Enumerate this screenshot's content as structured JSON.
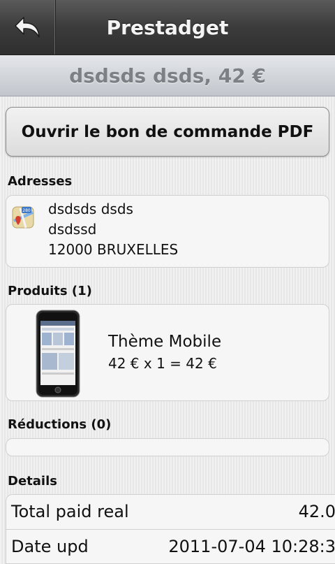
{
  "app": {
    "title": "Prestadget"
  },
  "order": {
    "header": "dsdsds dsds, 42 €"
  },
  "actions": {
    "pdf_label": "Ouvrir le bon de commande PDF"
  },
  "addresses": {
    "label": "Adresses",
    "icon": "map-icon",
    "lines": [
      "dsdsds dsds",
      "dsdssd",
      "12000 BRUXELLES"
    ]
  },
  "products": {
    "label": "Produits (1)",
    "items": [
      {
        "name": "Thème Mobile",
        "price_line": "42 € x 1 = 42 €",
        "image": "phone-thumbnail"
      }
    ]
  },
  "discounts": {
    "label": "Réductions (0)"
  },
  "details": {
    "label": "Details",
    "rows": [
      {
        "key": "Total paid real",
        "value": "42.0"
      },
      {
        "key": "Date upd",
        "value": "2011-07-04 10:28:3"
      }
    ]
  }
}
